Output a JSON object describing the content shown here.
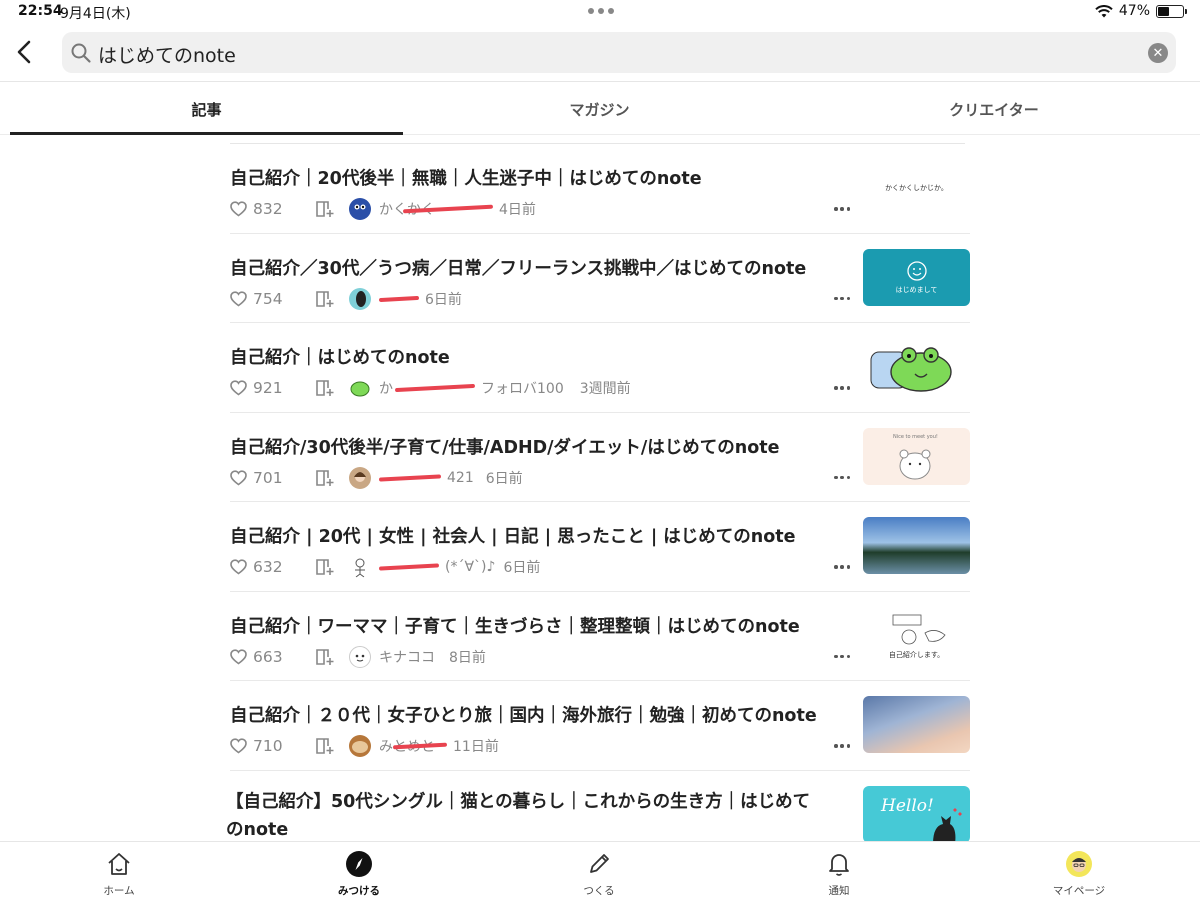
{
  "status": {
    "time": "22:54",
    "date": "9月4日(木)",
    "battery": "47%",
    "battery_level": 0.47
  },
  "search": {
    "query": "はじめてのnote"
  },
  "tabs": [
    {
      "label": "記事",
      "active": true
    },
    {
      "label": "マガジン",
      "active": false
    },
    {
      "label": "クリエイター",
      "active": false
    }
  ],
  "articles": [
    {
      "title": "自己紹介｜20代後半｜無職｜人生迷子中｜はじめてのnote",
      "likes": "832",
      "author": "かくかく",
      "follow": "",
      "ago": "4日前",
      "thumb_text": "かくかくしかじか。"
    },
    {
      "title": "自己紹介／30代／うつ病／日常／フリーランス挑戦中／はじめてのnote",
      "likes": "754",
      "author": "",
      "follow": "",
      "ago": "6日前",
      "thumb_text": "はじめまして"
    },
    {
      "title": "自己紹介｜はじめてのnote",
      "likes": "921",
      "author": "か",
      "follow": "フォロバ100",
      "ago": "3週間前",
      "thumb_text": ""
    },
    {
      "title": "自己紹介/30代後半/子育て/仕事/ADHD/ダイエット/はじめてのnote",
      "likes": "701",
      "author": "",
      "follow": "421",
      "ago": "6日前",
      "thumb_text": "Nice to meet you!"
    },
    {
      "title": "自己紹介 | 20代 | 女性 | 社会人 | 日記 | 思ったこと | はじめてのnote",
      "likes": "632",
      "author": "(*´∀`)♪",
      "follow": "",
      "ago": "6日前",
      "thumb_text": ""
    },
    {
      "title": "自己紹介｜ワーママ｜子育て｜生きづらさ｜整理整頓｜はじめてのnote",
      "likes": "663",
      "author": "キナココ",
      "follow": "",
      "ago": "8日前",
      "thumb_text": "自己紹介します。"
    },
    {
      "title": "自己紹介｜２０代｜女子ひとり旅｜国内｜海外旅行｜勉強｜初めてのnote",
      "likes": "710",
      "author": "みとめと",
      "follow": "",
      "ago": "11日前",
      "thumb_text": ""
    },
    {
      "title": "【自己紹介】50代シングル｜猫との暮らし｜これからの生き方｜はじめてのnote",
      "likes": "",
      "author": "",
      "follow": "",
      "ago": "",
      "thumb_text": "Hello!"
    }
  ],
  "bottom_nav": [
    {
      "label": "ホーム",
      "icon": "home-icon",
      "active": false
    },
    {
      "label": "みつける",
      "icon": "compass-icon",
      "active": true
    },
    {
      "label": "つくる",
      "icon": "pencil-icon",
      "active": false
    },
    {
      "label": "通知",
      "icon": "bell-icon",
      "active": false
    },
    {
      "label": "マイページ",
      "icon": "profile-avatar",
      "active": false
    }
  ]
}
